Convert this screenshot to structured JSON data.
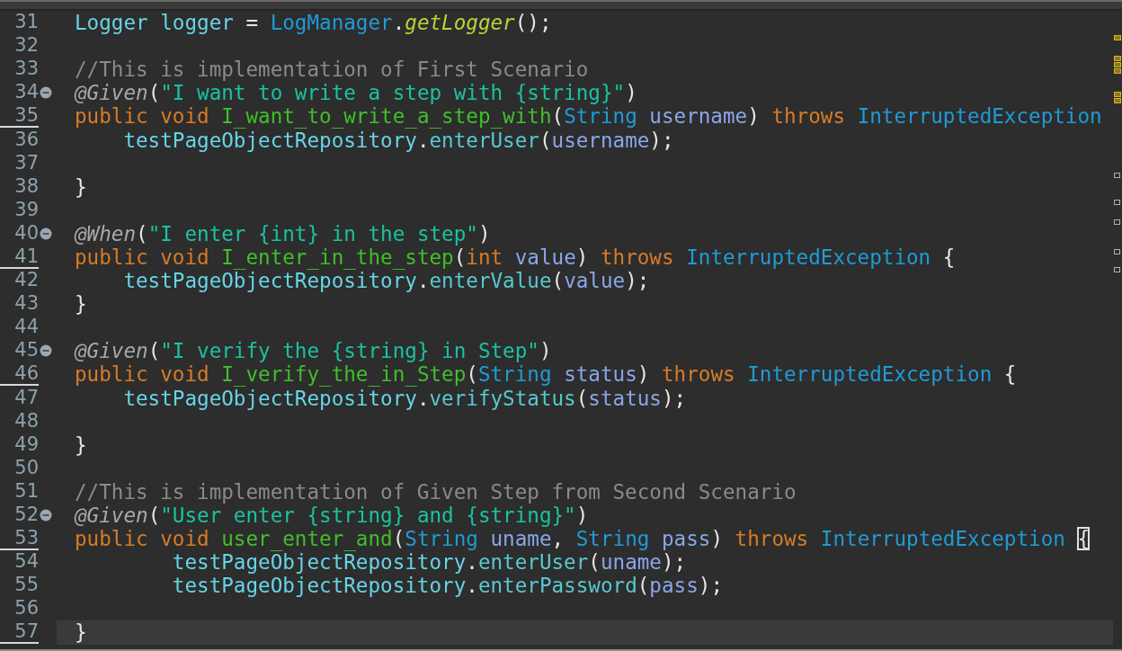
{
  "editor": {
    "lines": [
      {
        "number": "31",
        "fold": false,
        "marked": false,
        "current": false,
        "tokens": [
          {
            "kind": "v",
            "text": "Logger logger"
          },
          {
            "kind": "p",
            "text": " = "
          },
          {
            "kind": "ty",
            "text": "LogManager"
          },
          {
            "kind": "p",
            "text": "."
          },
          {
            "kind": "sm",
            "text": "getLogger"
          },
          {
            "kind": "p",
            "text": "();"
          }
        ]
      },
      {
        "number": "32",
        "fold": false,
        "marked": false,
        "current": false
      },
      {
        "number": "33",
        "fold": false,
        "marked": false,
        "current": false,
        "tokens": [
          {
            "kind": "c",
            "text": "//This is implementation of First Scenario"
          }
        ]
      },
      {
        "number": "34",
        "fold": true,
        "marked": false,
        "current": false,
        "tokens": [
          {
            "kind": "an",
            "text": "@Given"
          },
          {
            "kind": "p",
            "text": "("
          },
          {
            "kind": "s",
            "text": "\"I want to write a step with {string}\""
          },
          {
            "kind": "p",
            "text": ")"
          }
        ]
      },
      {
        "number": "35",
        "fold": false,
        "marked": true,
        "current": false,
        "tokens": [
          {
            "kind": "k",
            "text": "public void "
          },
          {
            "kind": "md",
            "text": "I_want_to_write_a_step_with"
          },
          {
            "kind": "p",
            "text": "("
          },
          {
            "kind": "ty",
            "text": "String"
          },
          {
            "kind": "pm",
            "text": " username"
          },
          {
            "kind": "p",
            "text": ") "
          },
          {
            "kind": "k",
            "text": "throws "
          },
          {
            "kind": "ty",
            "text": "InterruptedException"
          }
        ]
      },
      {
        "number": "36",
        "fold": false,
        "marked": false,
        "current": false,
        "tokens": [
          {
            "kind": "v",
            "text": "    testPageObjectRepository"
          },
          {
            "kind": "p",
            "text": "."
          },
          {
            "kind": "mc",
            "text": "enterUser"
          },
          {
            "kind": "p",
            "text": "("
          },
          {
            "kind": "pm",
            "text": "username"
          },
          {
            "kind": "p",
            "text": ");"
          }
        ]
      },
      {
        "number": "37",
        "fold": false,
        "marked": false,
        "current": false
      },
      {
        "number": "38",
        "fold": false,
        "marked": false,
        "current": false,
        "tokens": [
          {
            "kind": "p",
            "text": "}"
          }
        ]
      },
      {
        "number": "39",
        "fold": false,
        "marked": false,
        "current": false
      },
      {
        "number": "40",
        "fold": true,
        "marked": false,
        "current": false,
        "tokens": [
          {
            "kind": "an",
            "text": "@When"
          },
          {
            "kind": "p",
            "text": "("
          },
          {
            "kind": "s",
            "text": "\"I enter {int} in the step\""
          },
          {
            "kind": "p",
            "text": ")"
          }
        ]
      },
      {
        "number": "41",
        "fold": false,
        "marked": true,
        "current": false,
        "tokens": [
          {
            "kind": "k",
            "text": "public void "
          },
          {
            "kind": "md",
            "text": "I_enter_in_the_step"
          },
          {
            "kind": "p",
            "text": "("
          },
          {
            "kind": "k",
            "text": "int "
          },
          {
            "kind": "pm",
            "text": "value"
          },
          {
            "kind": "p",
            "text": ") "
          },
          {
            "kind": "k",
            "text": "throws "
          },
          {
            "kind": "ty",
            "text": "InterruptedException"
          },
          {
            "kind": "p",
            "text": " {"
          }
        ]
      },
      {
        "number": "42",
        "fold": false,
        "marked": false,
        "current": false,
        "tokens": [
          {
            "kind": "v",
            "text": "    testPageObjectRepository"
          },
          {
            "kind": "p",
            "text": "."
          },
          {
            "kind": "mc",
            "text": "enterValue"
          },
          {
            "kind": "p",
            "text": "("
          },
          {
            "kind": "pm",
            "text": "value"
          },
          {
            "kind": "p",
            "text": ");"
          }
        ]
      },
      {
        "number": "43",
        "fold": false,
        "marked": false,
        "current": false,
        "tokens": [
          {
            "kind": "p",
            "text": "}"
          }
        ]
      },
      {
        "number": "44",
        "fold": false,
        "marked": false,
        "current": false
      },
      {
        "number": "45",
        "fold": true,
        "marked": false,
        "current": false,
        "tokens": [
          {
            "kind": "an",
            "text": "@Given"
          },
          {
            "kind": "p",
            "text": "("
          },
          {
            "kind": "s",
            "text": "\"I verify the {string} in Step\""
          },
          {
            "kind": "p",
            "text": ")"
          }
        ]
      },
      {
        "number": "46",
        "fold": false,
        "marked": true,
        "current": false,
        "tokens": [
          {
            "kind": "k",
            "text": "public void "
          },
          {
            "kind": "md",
            "text": "I_verify_the_in_Step"
          },
          {
            "kind": "p",
            "text": "("
          },
          {
            "kind": "ty",
            "text": "String"
          },
          {
            "kind": "pm",
            "text": " status"
          },
          {
            "kind": "p",
            "text": ") "
          },
          {
            "kind": "k",
            "text": "throws "
          },
          {
            "kind": "ty",
            "text": "InterruptedException"
          },
          {
            "kind": "p",
            "text": " {"
          }
        ]
      },
      {
        "number": "47",
        "fold": false,
        "marked": false,
        "current": false,
        "tokens": [
          {
            "kind": "v",
            "text": "    testPageObjectRepository"
          },
          {
            "kind": "p",
            "text": "."
          },
          {
            "kind": "mc",
            "text": "verifyStatus"
          },
          {
            "kind": "p",
            "text": "("
          },
          {
            "kind": "pm",
            "text": "status"
          },
          {
            "kind": "p",
            "text": ");"
          }
        ]
      },
      {
        "number": "48",
        "fold": false,
        "marked": false,
        "current": false
      },
      {
        "number": "49",
        "fold": false,
        "marked": false,
        "current": false,
        "tokens": [
          {
            "kind": "p",
            "text": "}"
          }
        ]
      },
      {
        "number": "50",
        "fold": false,
        "marked": false,
        "current": false
      },
      {
        "number": "51",
        "fold": false,
        "marked": false,
        "current": false,
        "tokens": [
          {
            "kind": "c",
            "text": "//This is implementation of Given Step from Second Scenario"
          }
        ]
      },
      {
        "number": "52",
        "fold": true,
        "marked": false,
        "current": false,
        "tokens": [
          {
            "kind": "an",
            "text": "@Given"
          },
          {
            "kind": "p",
            "text": "("
          },
          {
            "kind": "s",
            "text": "\"User enter {string} and {string}\""
          },
          {
            "kind": "p",
            "text": ")"
          }
        ]
      },
      {
        "number": "53",
        "fold": false,
        "marked": true,
        "current": false,
        "tokens": [
          {
            "kind": "k",
            "text": "public void "
          },
          {
            "kind": "md",
            "text": "user_enter_and"
          },
          {
            "kind": "p",
            "text": "("
          },
          {
            "kind": "ty",
            "text": "String"
          },
          {
            "kind": "pm",
            "text": " uname"
          },
          {
            "kind": "p",
            "text": ", "
          },
          {
            "kind": "ty",
            "text": "String"
          },
          {
            "kind": "pm",
            "text": " pass"
          },
          {
            "kind": "p",
            "text": ") "
          },
          {
            "kind": "k",
            "text": "throws "
          },
          {
            "kind": "ty",
            "text": "InterruptedException "
          },
          {
            "kind": "bm",
            "text": "{"
          }
        ]
      },
      {
        "number": "54",
        "fold": false,
        "marked": false,
        "current": false,
        "tokens": [
          {
            "kind": "v",
            "text": "        testPageObjectRepository"
          },
          {
            "kind": "p",
            "text": "."
          },
          {
            "kind": "mc",
            "text": "enterUser"
          },
          {
            "kind": "p",
            "text": "("
          },
          {
            "kind": "pm",
            "text": "uname"
          },
          {
            "kind": "p",
            "text": ");"
          }
        ]
      },
      {
        "number": "55",
        "fold": false,
        "marked": false,
        "current": false,
        "tokens": [
          {
            "kind": "v",
            "text": "        testPageObjectRepository"
          },
          {
            "kind": "p",
            "text": "."
          },
          {
            "kind": "mc",
            "text": "enterPassword"
          },
          {
            "kind": "p",
            "text": "("
          },
          {
            "kind": "pm",
            "text": "pass"
          },
          {
            "kind": "p",
            "text": ");"
          }
        ]
      },
      {
        "number": "56",
        "fold": false,
        "marked": false,
        "current": false
      },
      {
        "number": "57",
        "fold": false,
        "marked": true,
        "current": true,
        "tokens": [
          {
            "kind": "p",
            "text": "}"
          }
        ]
      }
    ]
  }
}
